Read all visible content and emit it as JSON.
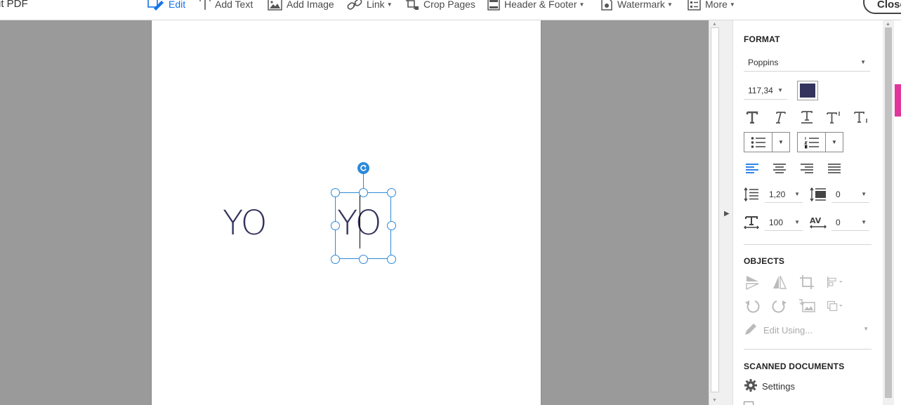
{
  "app": {
    "title": "it PDF"
  },
  "toolbar": {
    "edit": "Edit",
    "add_text": "Add Text",
    "add_image": "Add Image",
    "link": "Link",
    "crop_pages": "Crop Pages",
    "header_footer": "Header & Footer",
    "watermark": "Watermark",
    "more": "More",
    "close": "Close"
  },
  "document": {
    "text_left": "YO",
    "text_selected": "YO"
  },
  "format": {
    "title": "FORMAT",
    "font": "Poppins",
    "size": "117,34",
    "color": "#33335e",
    "line_spacing": "1,20",
    "paragraph_spacing": "0",
    "horizontal_scale": "100",
    "char_spacing": "0"
  },
  "objects": {
    "title": "OBJECTS",
    "edit_using": "Edit Using..."
  },
  "scanned": {
    "title": "SCANNED DOCUMENTS",
    "settings": "Settings"
  },
  "colors": {
    "accent": "#1473e6",
    "selection": "#2d89d8",
    "pink_tab": "#e0359a"
  }
}
